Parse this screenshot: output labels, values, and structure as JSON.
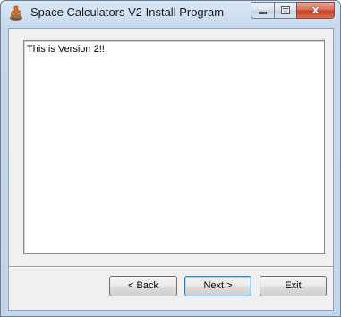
{
  "window": {
    "title": "Space Calculators V2 Install Program",
    "icon": "installer-icon"
  },
  "caption": {
    "minimize_icon": "minimize-icon",
    "maximize_icon": "maximize-icon",
    "close_icon": "close-icon",
    "close_glyph": "x"
  },
  "content": {
    "text": "This is Version 2!!"
  },
  "buttons": {
    "back": "< Back",
    "next": "Next >",
    "exit": "Exit"
  },
  "colors": {
    "close_button": "#c5422a",
    "default_button_border": "#3c7fb1"
  }
}
